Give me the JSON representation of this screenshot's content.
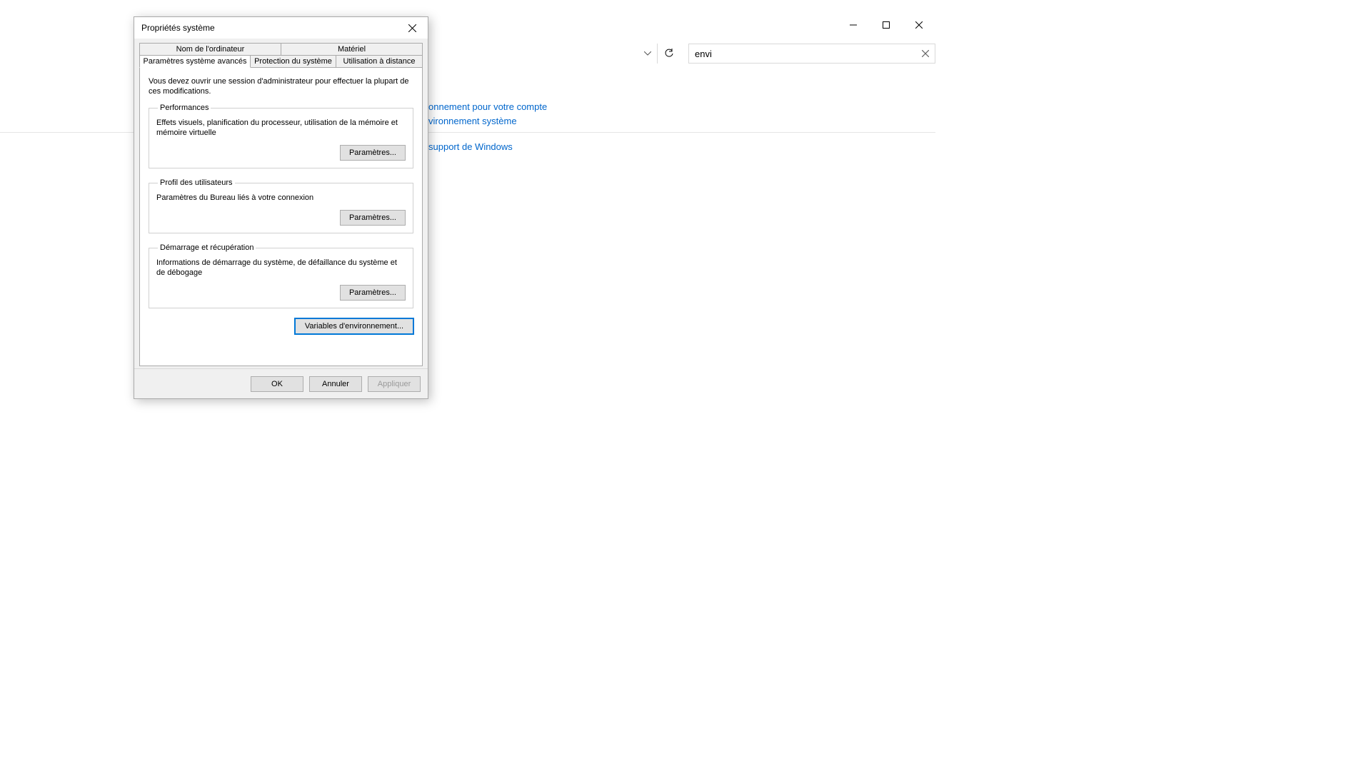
{
  "bg": {
    "search_value": "envi",
    "link_account": "onnement pour votre compte",
    "link_system": "vironnement système",
    "link_help": "support de Windows"
  },
  "dialog": {
    "title": "Propriétés système",
    "tabs": {
      "row1": [
        "Nom de l'ordinateur",
        "Matériel"
      ],
      "row2": [
        "Paramètres système avancés",
        "Protection du système",
        "Utilisation à distance"
      ]
    },
    "admin_note": "Vous devez ouvrir une session d'administrateur pour effectuer la plupart de ces modifications.",
    "perf": {
      "legend": "Performances",
      "desc": "Effets visuels, planification du processeur, utilisation de la mémoire et mémoire virtuelle",
      "button": "Paramètres..."
    },
    "profile": {
      "legend": "Profil des utilisateurs",
      "desc": "Paramètres du Bureau liés à votre connexion",
      "button": "Paramètres..."
    },
    "startup": {
      "legend": "Démarrage et récupération",
      "desc": "Informations de démarrage du système, de défaillance du système et de débogage",
      "button": "Paramètres..."
    },
    "env_button": "Variables d'environnement...",
    "footer": {
      "ok": "OK",
      "cancel": "Annuler",
      "apply": "Appliquer"
    }
  }
}
